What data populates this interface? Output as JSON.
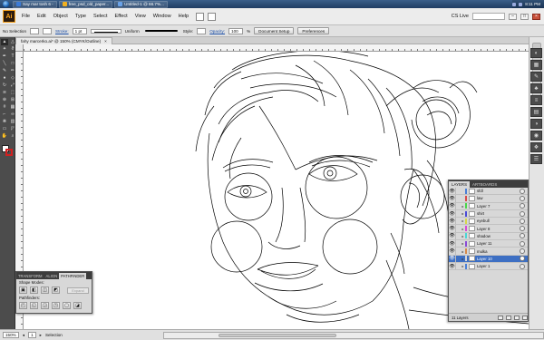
{
  "taskbar": {
    "tasks": [
      "Say mar tosh 6 -",
      "free_psd_old_paper...",
      "Untitled-1 @ 66.7%..."
    ],
    "clock": "8:11 PM"
  },
  "app": {
    "logo": "Ai",
    "menus": [
      "File",
      "Edit",
      "Object",
      "Type",
      "Select",
      "Effect",
      "View",
      "Window",
      "Help"
    ],
    "cslive": "CS Live"
  },
  "control": {
    "selection": "No Selection",
    "stroke_label": "Stroke:",
    "stroke_value": "1 pt",
    "uniform": "Uniform",
    "style_label": "Style:",
    "opacity_label": "Opacity:",
    "opacity_value": "100",
    "opacity_unit": "%",
    "doc_setup": "Document Setup",
    "preferences": "Preferences"
  },
  "document": {
    "tab_title": "fahy marcerko.ai* @ 150% (CMYK/Outline)",
    "close": "×"
  },
  "pathfinder": {
    "tabs": [
      "TRANSFORM",
      "ALIGN",
      "PATHFINDER"
    ],
    "shape_modes": "Shape Modes:",
    "pathfinders": "Pathfinders:",
    "expand": "Expand"
  },
  "layers": {
    "tabs": [
      "LAYERS",
      "ARTBOARDS"
    ],
    "items": [
      {
        "name": "sfdl",
        "color": "#4a7fd6",
        "expanded": false,
        "selected": false
      },
      {
        "name": "law",
        "color": "#d64a4a",
        "expanded": false,
        "selected": false
      },
      {
        "name": "Layer 7",
        "color": "#4ad64a",
        "expanded": true,
        "selected": false
      },
      {
        "name": "shirt",
        "color": "#4a4ad6",
        "expanded": true,
        "selected": false
      },
      {
        "name": "eyebull",
        "color": "#d6d64a",
        "expanded": true,
        "selected": false
      },
      {
        "name": "Layer 8",
        "color": "#d64ad6",
        "expanded": true,
        "selected": false
      },
      {
        "name": "shadow",
        "color": "#4ad6d6",
        "expanded": true,
        "selected": false
      },
      {
        "name": "Layer 11",
        "color": "#8a4ad6",
        "expanded": true,
        "selected": false
      },
      {
        "name": "mulka",
        "color": "#d68a4a",
        "expanded": true,
        "selected": false
      },
      {
        "name": "Layer 10",
        "color": "#d6d6d6",
        "expanded": true,
        "selected": true
      },
      {
        "name": "Layer 1",
        "color": "#4a7fd6",
        "expanded": true,
        "selected": false
      }
    ],
    "count": "11 Layers"
  },
  "status": {
    "zoom": "150%",
    "page": "1",
    "mode": "Selection"
  }
}
